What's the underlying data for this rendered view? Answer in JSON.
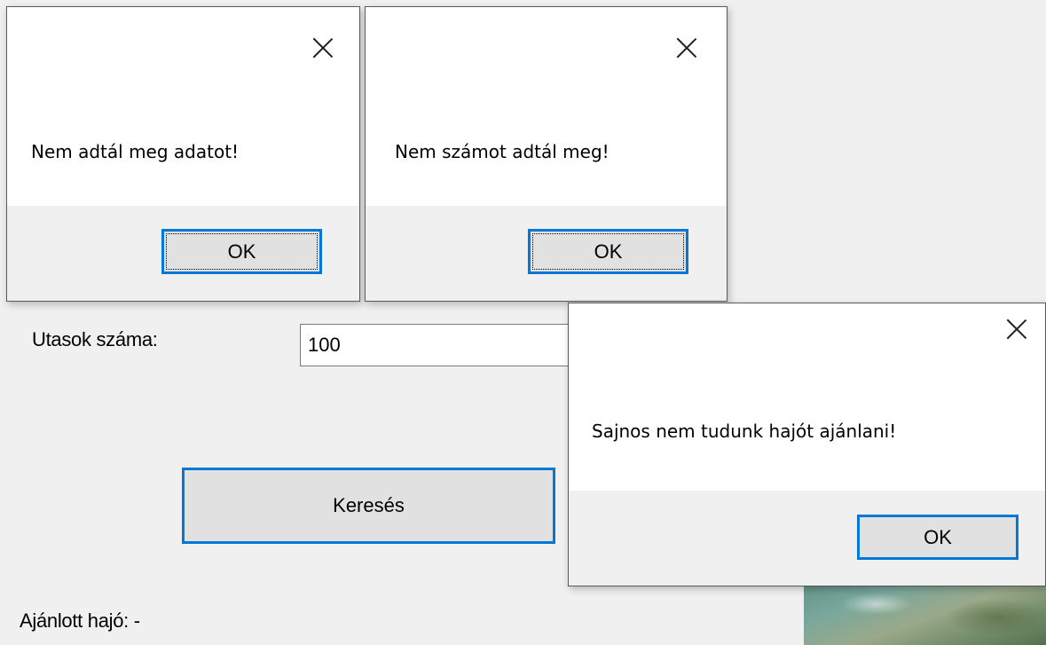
{
  "main_form": {
    "passengers_label": "Utasok száma:",
    "passengers_value": "100",
    "search_button": "Keresés",
    "recommended_label": "Ajánlott hajó: -"
  },
  "dialogs": [
    {
      "message": "Nem adtál meg adatot!",
      "ok": "OK"
    },
    {
      "message": "Nem számot adtál meg!",
      "ok": "OK"
    },
    {
      "message": "Sajnos nem tudunk hajót ajánlani!",
      "ok": "OK"
    }
  ],
  "colors": {
    "focus_border": "#0078d7",
    "button_face": "#e1e1e1",
    "form_background": "#f0f0f0"
  }
}
